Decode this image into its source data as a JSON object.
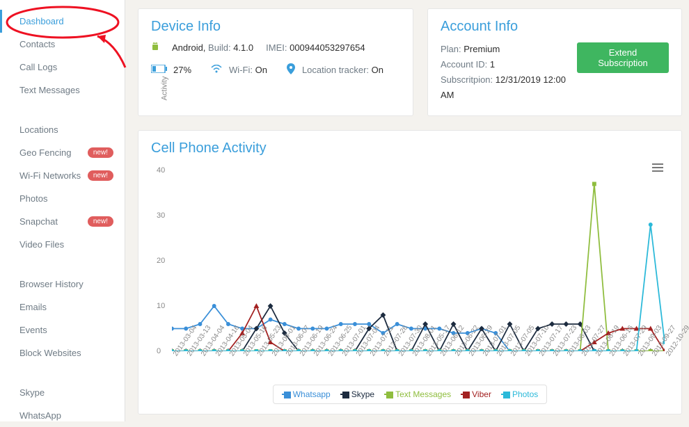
{
  "sidebar": {
    "sections": [
      {
        "items": [
          {
            "label": "Dashboard",
            "active": true
          },
          {
            "label": "Contacts"
          },
          {
            "label": "Call Logs"
          },
          {
            "label": "Text Messages"
          }
        ]
      },
      {
        "items": [
          {
            "label": "Locations"
          },
          {
            "label": "Geo Fencing",
            "badge": "new!"
          },
          {
            "label": "Wi-Fi Networks",
            "badge": "new!"
          },
          {
            "label": "Photos"
          },
          {
            "label": "Snapchat",
            "badge": "new!"
          },
          {
            "label": "Video Files"
          }
        ]
      },
      {
        "items": [
          {
            "label": "Browser History"
          },
          {
            "label": "Emails"
          },
          {
            "label": "Events"
          },
          {
            "label": "Block Websites"
          }
        ]
      },
      {
        "items": [
          {
            "label": "Skype"
          },
          {
            "label": "WhatsApp"
          }
        ]
      }
    ]
  },
  "device": {
    "title": "Device Info",
    "os_name": "Android,",
    "build_label": "Build:",
    "build_value": "4.1.0",
    "imei_label": "IMEI:",
    "imei_value": "000944053297654",
    "battery_pct": "27%",
    "wifi_label": "Wi-Fi:",
    "wifi_value": "On",
    "location_label": "Location tracker:",
    "location_value": "On"
  },
  "account": {
    "title": "Account Info",
    "plan_label": "Plan:",
    "plan_value": "Premium",
    "id_label": "Account ID:",
    "id_value": "1",
    "sub_label": "Subscritpion:",
    "sub_value": "12/31/2019 12:00 AM",
    "extend_label": "Extend Subscription"
  },
  "chart": {
    "title": "Cell Phone Activity",
    "ylabel": "Activity",
    "legend": {
      "whatsapp": "Whatsapp",
      "skype": "Skype",
      "text": "Text Messages",
      "viber": "Viber",
      "photos": "Photos"
    }
  },
  "chart_data": {
    "type": "line",
    "xlabel": "",
    "ylabel": "Activity",
    "ylim": [
      0,
      40
    ],
    "yticks": [
      0,
      10,
      20,
      30,
      40
    ],
    "title": "Cell Phone Activity",
    "legend_position": "bottom",
    "categories": [
      "2013-03-04",
      "2013-03-13",
      "2013-04-04",
      "2013-04-16",
      "2013-05-04",
      "2013-05-16",
      "2013-05-23",
      "2013-06-01",
      "2013-06-07",
      "2013-06-19",
      "2013-06-24",
      "2013-06-25",
      "2013-07-01",
      "2013-07-04",
      "2013-07-11",
      "2013-07-26",
      "2013-07-30",
      "2013-08-01",
      "2013-05-17",
      "2013-06-12",
      "2013-06-22",
      "2013-06-29",
      "2013-07-01",
      "2013-07-05",
      "2013-07-05",
      "2013-07-10",
      "2013-07-17",
      "2013-07-23",
      "2013-08-03",
      "2013-07-27",
      "2013-06-19",
      "2013-06-16",
      "2013-07-29",
      "2013-09-03",
      "2013-09-27",
      "2012-10-29"
    ],
    "series": [
      {
        "name": "Whatsapp",
        "color": "#3a8fd8",
        "values": [
          5,
          5,
          6,
          10,
          6,
          5,
          5,
          7,
          6,
          5,
          5,
          5,
          6,
          6,
          6,
          4,
          6,
          5,
          5,
          5,
          4,
          4,
          5,
          4,
          0,
          0,
          0,
          0,
          0,
          0,
          0,
          0,
          0,
          0,
          0,
          0
        ]
      },
      {
        "name": "Skype",
        "color": "#1c2b3f",
        "values": [
          0,
          0,
          0,
          0,
          0,
          0,
          5,
          10,
          4,
          0,
          0,
          0,
          0,
          0,
          5,
          8,
          0,
          0,
          6,
          0,
          6,
          0,
          5,
          0,
          6,
          0,
          5,
          6,
          6,
          6,
          0,
          0,
          0,
          0,
          0,
          0
        ]
      },
      {
        "name": "Text Messages",
        "color": "#8fbd3e",
        "values": [
          0,
          0,
          0,
          0,
          0,
          0,
          0,
          0,
          0,
          0,
          0,
          0,
          0,
          0,
          0,
          0,
          0,
          0,
          0,
          0,
          0,
          0,
          0,
          0,
          0,
          0,
          0,
          0,
          0,
          0,
          37,
          0,
          0,
          0,
          0,
          0
        ]
      },
      {
        "name": "Viber",
        "color": "#a32121",
        "values": [
          0,
          0,
          0,
          0,
          0,
          4,
          10,
          2,
          0,
          0,
          0,
          0,
          0,
          0,
          0,
          0,
          0,
          0,
          0,
          0,
          0,
          0,
          0,
          0,
          0,
          0,
          0,
          0,
          0,
          0,
          2,
          4,
          5,
          5,
          5,
          0
        ]
      },
      {
        "name": "Photos",
        "color": "#2bb9d9",
        "values": [
          0,
          0,
          0,
          0,
          0,
          0,
          0,
          0,
          0,
          0,
          0,
          0,
          0,
          0,
          0,
          0,
          0,
          0,
          0,
          0,
          0,
          0,
          0,
          0,
          0,
          0,
          0,
          0,
          0,
          0,
          0,
          0,
          0,
          0,
          28,
          2
        ]
      }
    ]
  }
}
